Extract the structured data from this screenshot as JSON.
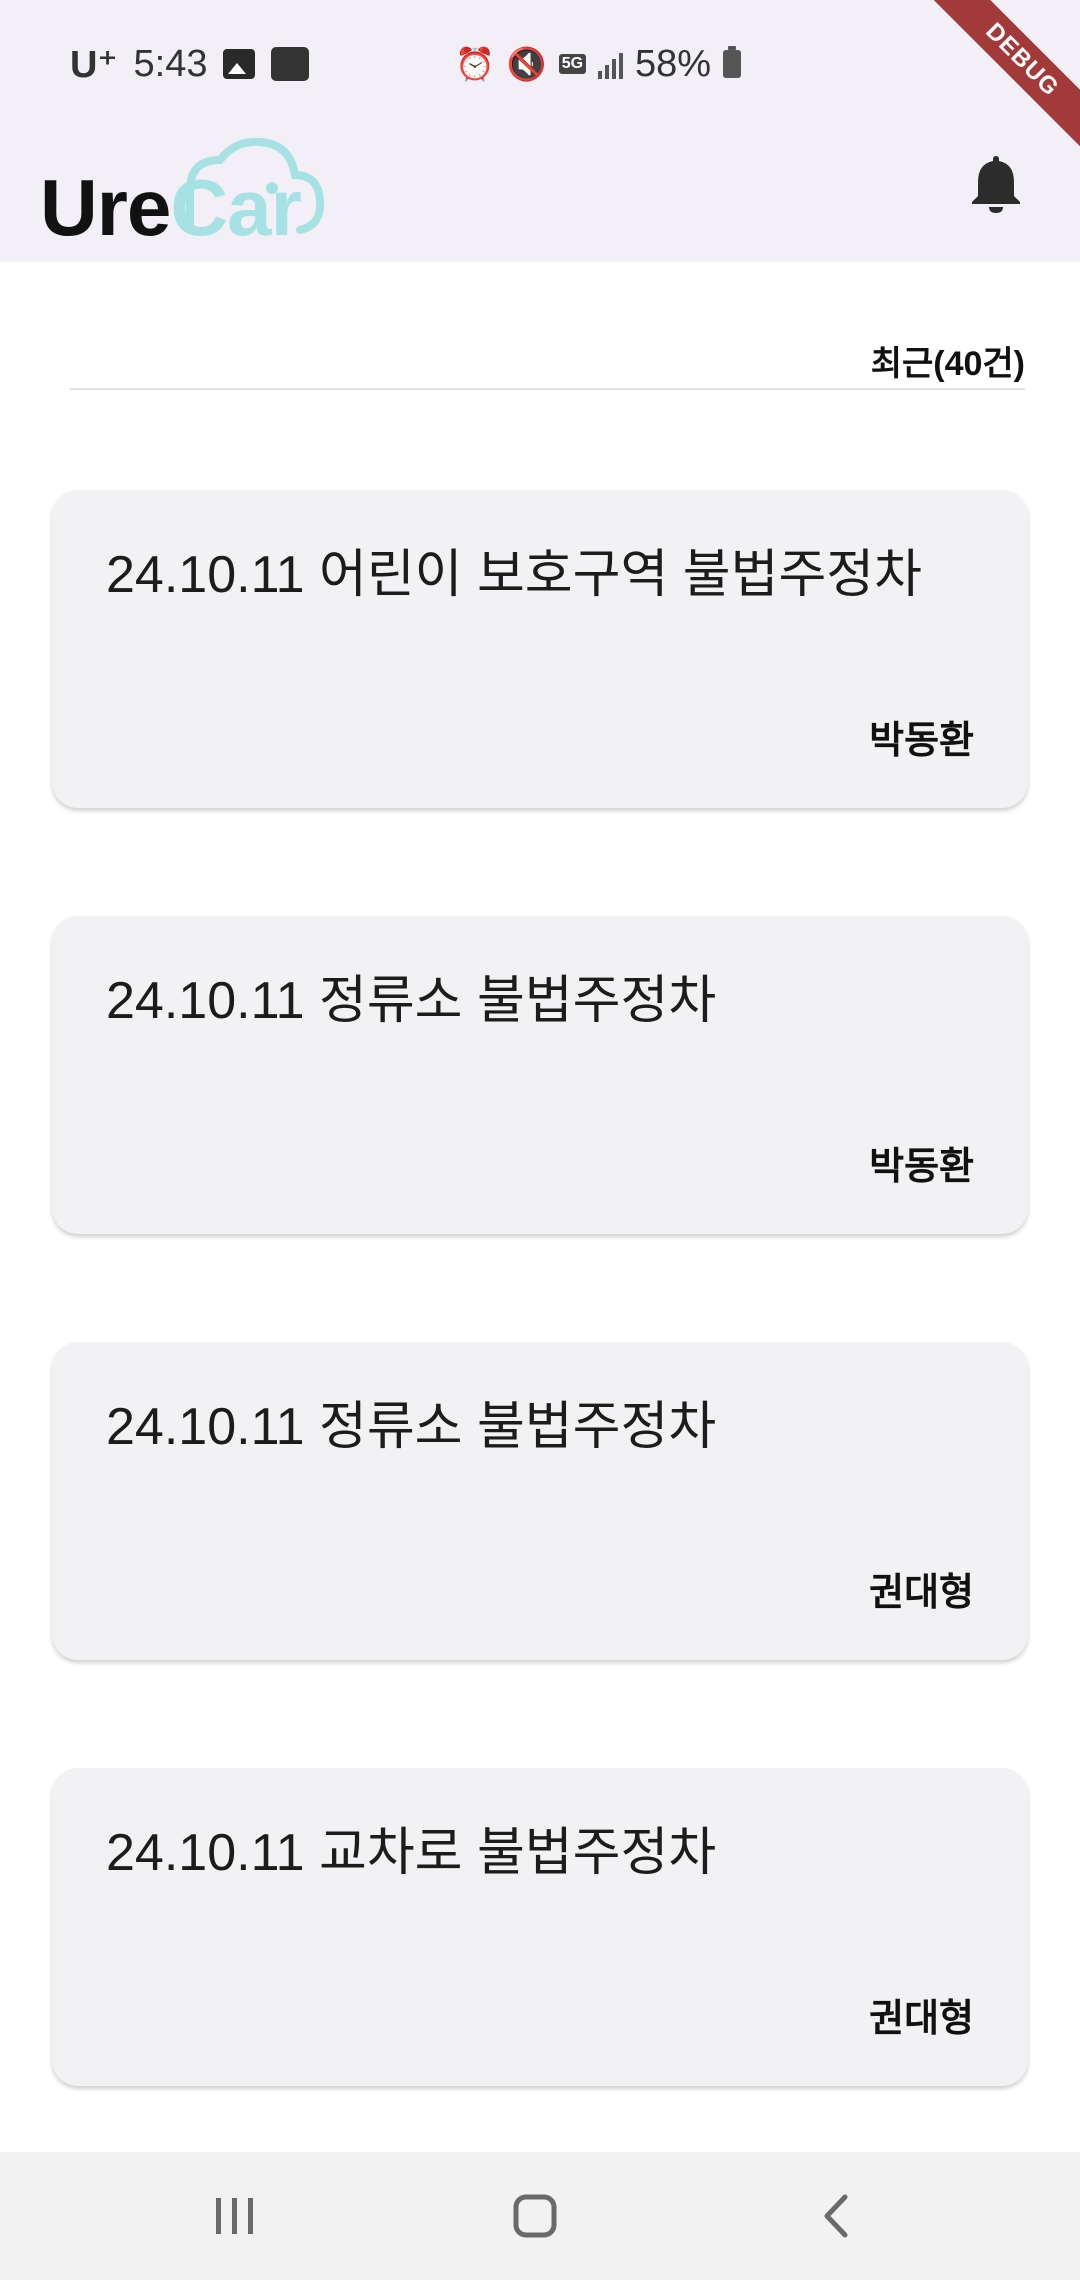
{
  "status_bar": {
    "carrier": "U⁺",
    "time": "5:43",
    "network": "5G",
    "battery": "58%",
    "icons": [
      "gallery-icon",
      "tmoney-icon",
      "alarm-icon",
      "mute-icon",
      "5g-icon",
      "signal-icon",
      "battery-icon"
    ]
  },
  "debug_banner": "DEBUG",
  "app_bar": {
    "logo_part1": "Ure",
    "logo_part2": "Car",
    "logo_colors": {
      "ure": "#111111",
      "car": "#a6e1e4"
    },
    "notification_icon": "bell-icon"
  },
  "list_header": {
    "filter_label": "최근(40건)"
  },
  "reports": [
    {
      "title": "24.10.11 어린이 보호구역 불법주정차",
      "author": "박동환"
    },
    {
      "title": "24.10.11 정류소 불법주정차",
      "author": "박동환"
    },
    {
      "title": "24.10.11 정류소 불법주정차",
      "author": "권대형"
    },
    {
      "title": "24.10.11 교차로 불법주정차",
      "author": "권대형"
    }
  ],
  "nav_bar": {
    "buttons": [
      "recents-icon",
      "home-icon",
      "back-icon"
    ]
  }
}
